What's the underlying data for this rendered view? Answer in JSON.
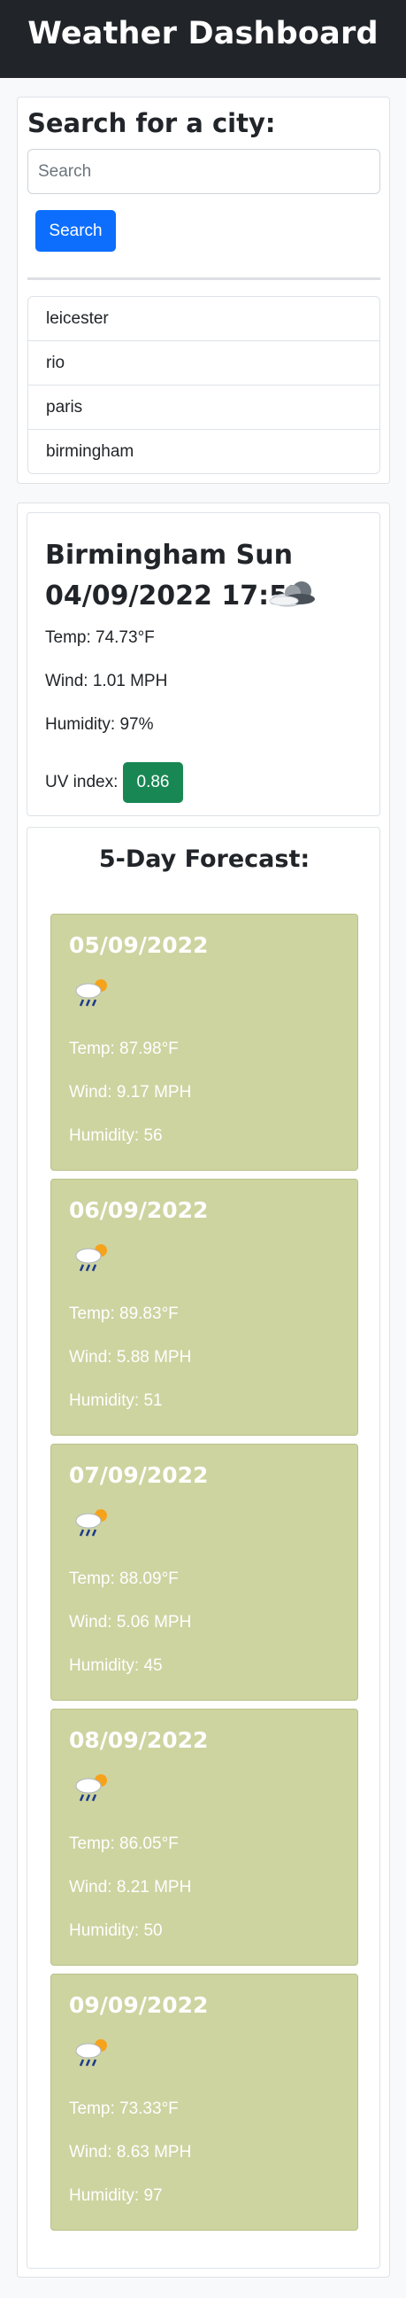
{
  "header": {
    "title": "Weather Dashboard"
  },
  "search": {
    "heading": "Search for a city:",
    "placeholder": "Search",
    "value": "",
    "button_label": "Search",
    "history": [
      "leicester",
      "rio",
      "paris",
      "birmingham"
    ]
  },
  "current": {
    "city_line": "Birmingham Sun",
    "datetime": "04/09/2022 17:55",
    "icon": "cloud-icon",
    "temp": "Temp: 74.73°F",
    "wind": "Wind: 1.01 MPH",
    "humidity": "Humidity: 97%",
    "uv_label": "UV index:",
    "uv_value": "0.86",
    "uv_color": "#198754"
  },
  "forecast": {
    "title": "5-Day Forecast:",
    "card_color": "#cdd4a0",
    "days": [
      {
        "date": "05/09/2022",
        "icon": "rain-sun-icon",
        "temp": "Temp: 87.98°F",
        "wind": "Wind: 9.17 MPH",
        "humidity": "Humidity: 56"
      },
      {
        "date": "06/09/2022",
        "icon": "rain-sun-icon",
        "temp": "Temp: 89.83°F",
        "wind": "Wind: 5.88 MPH",
        "humidity": "Humidity: 51"
      },
      {
        "date": "07/09/2022",
        "icon": "rain-sun-icon",
        "temp": "Temp: 88.09°F",
        "wind": "Wind: 5.06 MPH",
        "humidity": "Humidity: 45"
      },
      {
        "date": "08/09/2022",
        "icon": "rain-sun-icon",
        "temp": "Temp: 86.05°F",
        "wind": "Wind: 8.21 MPH",
        "humidity": "Humidity: 50"
      },
      {
        "date": "09/09/2022",
        "icon": "rain-sun-icon",
        "temp": "Temp: 73.33°F",
        "wind": "Wind: 8.63 MPH",
        "humidity": "Humidity: 97"
      }
    ]
  }
}
